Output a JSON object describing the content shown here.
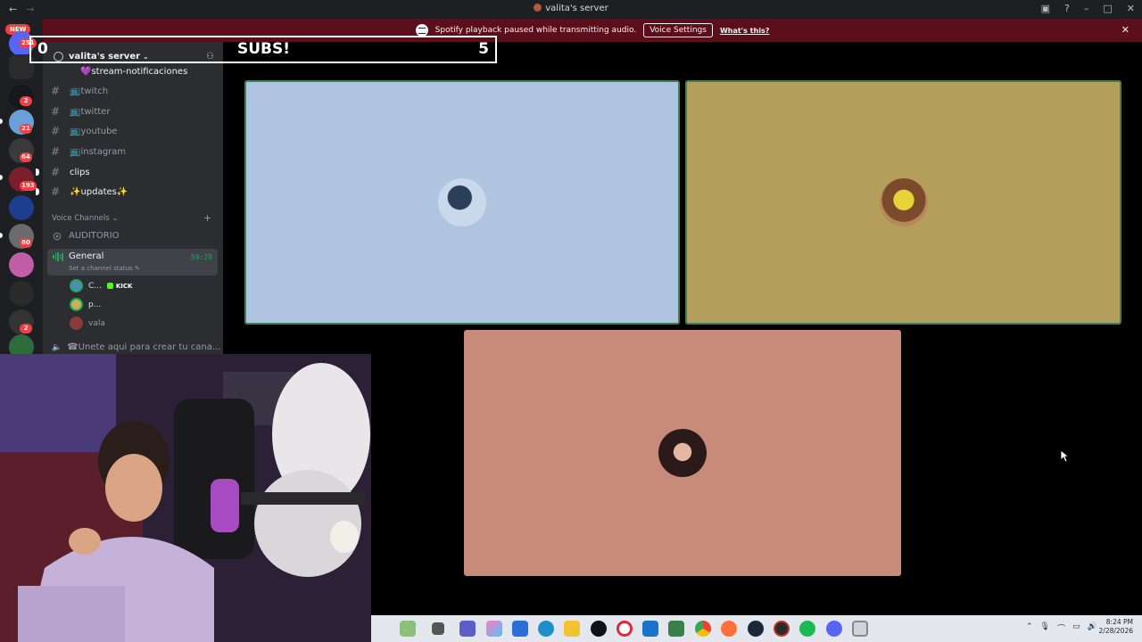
{
  "window": {
    "title": "valita's server",
    "back_icon": "arrow-left",
    "forward_icon": "arrow-right"
  },
  "notice": {
    "text": "Spotify playback paused while transmitting audio.",
    "voice_settings_label": "Voice Settings",
    "whats_this_label": "What's this?",
    "close_icon": "close-icon"
  },
  "rail": {
    "new_label": "NEW",
    "badges": [
      "251",
      "2",
      "21",
      "64",
      "193",
      "80",
      "2"
    ]
  },
  "server": {
    "name": "valita's server"
  },
  "channels": {
    "partial": "💜stream-notificaciones",
    "items": [
      {
        "label": "📺twitch"
      },
      {
        "label": "📺twitter"
      },
      {
        "label": "📺youtube"
      },
      {
        "label": "📺instagram"
      },
      {
        "label": "clips"
      },
      {
        "label": "✨updates✨"
      }
    ],
    "voice_category": "Voice Channels",
    "auditorio": "AUDITORIO",
    "general": {
      "name": "General",
      "timer": "59:29",
      "status_placeholder": "Set a channel status"
    },
    "members": [
      {
        "name": "C...",
        "tag": "KICK"
      },
      {
        "name": "p..."
      },
      {
        "name": "vala"
      }
    ],
    "create_channel": "☎Unete aqui para crear tu cana..."
  },
  "overlay": {
    "left_count": "0",
    "label": "SUBS!",
    "right_count": "5"
  },
  "tiles": {
    "colors": [
      "#afc5df",
      "#b39e5c",
      "#c88a79"
    ]
  },
  "taskbar": {
    "time": "8:24 PM",
    "date": "2/28/2026"
  }
}
